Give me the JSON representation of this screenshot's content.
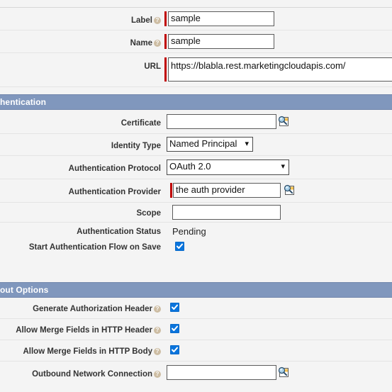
{
  "page": {
    "background_color": "#f4f4f4",
    "section_header_color": "#8097bd",
    "required_marker_color": "#c00000",
    "checkbox_color": "#0a74dc"
  },
  "sections": [
    {
      "id": "authentication",
      "title": "hentication",
      "full_title": "Authentication"
    },
    {
      "id": "callout_options",
      "title": "out Options",
      "full_title": "Callout Options"
    }
  ],
  "fields": {
    "label": {
      "label": "Label",
      "help": "?",
      "value": "sample",
      "required": true
    },
    "name": {
      "label": "Name",
      "help": "?",
      "value": "sample",
      "required": true
    },
    "url": {
      "label": "URL",
      "value": "https://blabla.rest.marketingcloudapis.com/",
      "required": true
    },
    "certificate": {
      "label": "Certificate",
      "value": "",
      "placeholder": ""
    },
    "identity_type": {
      "label": "Identity Type",
      "value": "Named Principal",
      "options": [
        "Named Principal"
      ]
    },
    "authentication_protocol": {
      "label": "Authentication Protocol",
      "value": "OAuth 2.0",
      "options": [
        "OAuth 2.0"
      ]
    },
    "authentication_provider": {
      "label": "Authentication Provider",
      "value": "the auth provider",
      "required": true
    },
    "scope": {
      "label": "Scope",
      "value": "",
      "placeholder": ""
    },
    "authentication_status": {
      "label": "Authentication Status",
      "value": "Pending"
    },
    "start_authentication_flow_on_save": {
      "label": "Start Authentication Flow on Save",
      "checked": true
    },
    "generate_authorization_header": {
      "label": "Generate Authorization Header",
      "help": "?",
      "checked": true
    },
    "allow_merge_fields_in_http_header": {
      "label": "Allow Merge Fields in HTTP Header",
      "help": "?",
      "checked": true
    },
    "allow_merge_fields_in_http_body": {
      "label": "Allow Merge Fields in HTTP Body",
      "help": "?",
      "checked": true
    },
    "outbound_network_connection": {
      "label": "Outbound Network Connection",
      "help": "?",
      "value": "",
      "placeholder": ""
    }
  },
  "icons": {
    "lookup": "lookup-icon",
    "help": "help-icon",
    "chevron": "chevron-down-icon",
    "check": "check-icon"
  }
}
